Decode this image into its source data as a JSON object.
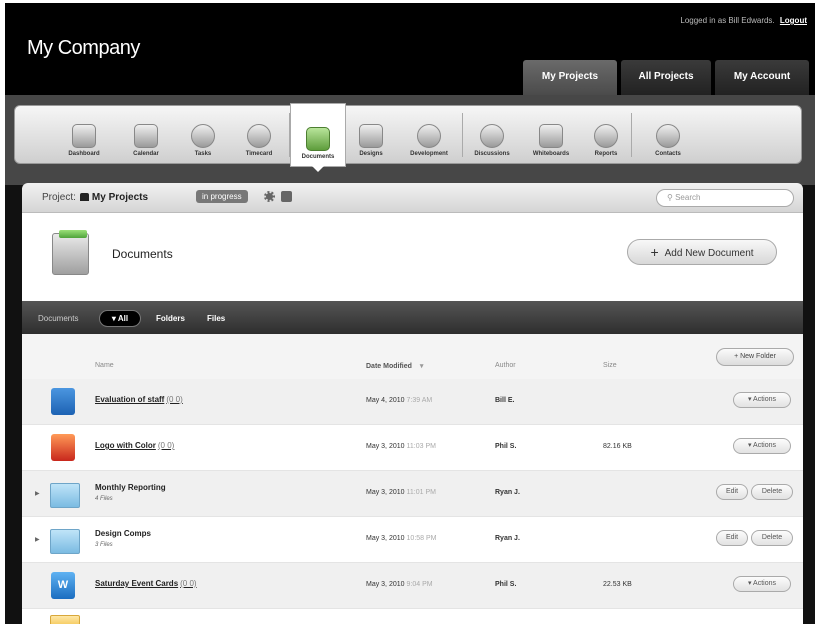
{
  "header": {
    "login_text": "Logged in as Bill Edwards.",
    "logout_label": "Logout",
    "company": "My Company",
    "tabs": [
      {
        "label": "My Projects",
        "active": true
      },
      {
        "label": "All Projects",
        "active": false
      },
      {
        "label": "My Account",
        "active": false
      }
    ]
  },
  "toolbar": {
    "items": [
      {
        "label": "Dashboard",
        "icon": "dashboard-icon"
      },
      {
        "label": "Calendar",
        "icon": "calendar-icon"
      },
      {
        "label": "Tasks",
        "icon": "tasks-icon"
      },
      {
        "label": "Timecard",
        "icon": "timecard-icon"
      },
      {
        "label": "Documents",
        "icon": "documents-icon",
        "active": true
      },
      {
        "label": "Designs",
        "icon": "designs-icon"
      },
      {
        "label": "Development",
        "icon": "development-icon"
      },
      {
        "label": "Discussions",
        "icon": "discussions-icon"
      },
      {
        "label": "Whiteboards",
        "icon": "whiteboards-icon"
      },
      {
        "label": "Reports",
        "icon": "reports-icon"
      },
      {
        "label": "Contacts",
        "icon": "contacts-icon"
      }
    ]
  },
  "project": {
    "label": "Project:",
    "name": "My Projects",
    "status": "in progress",
    "search_placeholder": "Search"
  },
  "documents": {
    "title": "Documents",
    "add_label": "Add New Document",
    "filter_label": "Documents",
    "filters": [
      "▾ All",
      "Folders",
      "Files"
    ],
    "new_folder_label": "+ New Folder",
    "columns": {
      "name": "Name",
      "date": "Date Modified",
      "date_sort": "▾",
      "author": "Author",
      "size": "Size"
    },
    "rows": [
      {
        "type": "doc",
        "name": "Evaluation of staff",
        "count": "(0 0)",
        "date": "May 4, 2010",
        "time": "7:39 AM",
        "author": "Bill E.",
        "size": "",
        "actions": "▾ Actions"
      },
      {
        "type": "img",
        "name": "Logo with Color",
        "count": "(0 0)",
        "date": "May 3, 2010",
        "time": "11:03 PM",
        "author": "Phil S.",
        "size": "82.16 KB",
        "actions": "▾ Actions"
      },
      {
        "type": "folder",
        "name": "Monthly Reporting",
        "sub": "4 Files",
        "date": "May 3, 2010",
        "time": "11:01 PM",
        "author": "Ryan J.",
        "size": "",
        "edit": "Edit",
        "delete": "Delete"
      },
      {
        "type": "folder",
        "name": "Design Comps",
        "sub": "3 Files",
        "date": "May 3, 2010",
        "time": "10:58 PM",
        "author": "Ryan J.",
        "size": "",
        "edit": "Edit",
        "delete": "Delete"
      },
      {
        "type": "word",
        "name": "Saturday Event Cards",
        "count": "(0 0)",
        "date": "May 3, 2010",
        "time": "9:04 PM",
        "author": "Phil S.",
        "size": "22.53 KB",
        "actions": "▾ Actions"
      }
    ]
  }
}
